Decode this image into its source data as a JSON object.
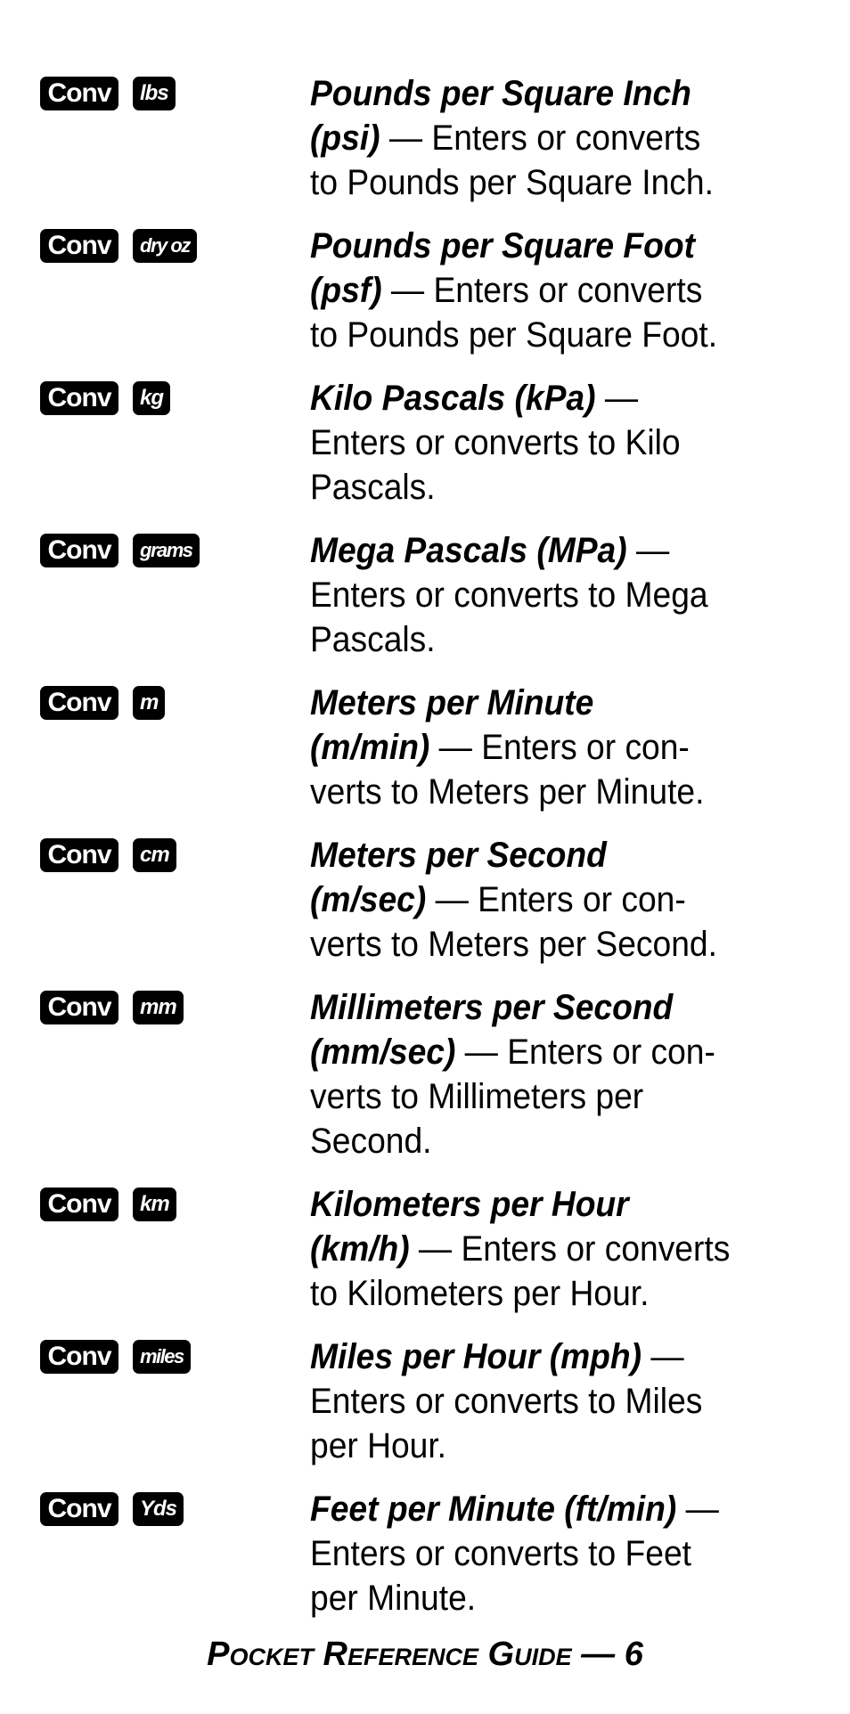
{
  "entries": [
    {
      "keys": [
        "Conv",
        "lbs"
      ],
      "lines": [
        [
          {
            "b": "Pounds per Square Inch"
          }
        ],
        [
          {
            "b": "(psi)"
          },
          {
            "t": " — Enters or converts"
          }
        ],
        [
          {
            "t": "to Pounds per Square Inch."
          }
        ]
      ]
    },
    {
      "keys": [
        "Conv",
        "dry oz"
      ],
      "lines": [
        [
          {
            "b": "Pounds per Square Foot"
          }
        ],
        [
          {
            "b": "(psf)"
          },
          {
            "t": " — Enters or converts"
          }
        ],
        [
          {
            "t": "to Pounds per Square Foot."
          }
        ]
      ]
    },
    {
      "keys": [
        "Conv",
        "kg"
      ],
      "lines": [
        [
          {
            "b": "Kilo Pascals (kPa)"
          },
          {
            "t": " —"
          }
        ],
        [
          {
            "t": "Enters or converts to Kilo"
          }
        ],
        [
          {
            "t": "Pascals."
          }
        ]
      ]
    },
    {
      "keys": [
        "Conv",
        "grams"
      ],
      "lines": [
        [
          {
            "b": "Mega Pascals (MPa)"
          },
          {
            "t": " —"
          }
        ],
        [
          {
            "t": "Enters or converts to Mega"
          }
        ],
        [
          {
            "t": "Pascals."
          }
        ]
      ]
    },
    {
      "keys": [
        "Conv",
        "m"
      ],
      "lines": [
        [
          {
            "b": "Meters per Minute"
          }
        ],
        [
          {
            "b": "(m/min)"
          },
          {
            "t": " — Enters or con-"
          }
        ],
        [
          {
            "t": "verts to Meters per Minute."
          }
        ]
      ]
    },
    {
      "keys": [
        "Conv",
        "cm"
      ],
      "lines": [
        [
          {
            "b": "Meters per Second"
          }
        ],
        [
          {
            "b": "(m/sec)"
          },
          {
            "t": " — Enters or con-"
          }
        ],
        [
          {
            "t": "verts to Meters per Second."
          }
        ]
      ]
    },
    {
      "keys": [
        "Conv",
        "mm"
      ],
      "lines": [
        [
          {
            "b": "Millimeters per Second"
          }
        ],
        [
          {
            "b": "(mm/sec)"
          },
          {
            "t": " — Enters or con-"
          }
        ],
        [
          {
            "t": "verts to Millimeters per"
          }
        ],
        [
          {
            "t": "Second."
          }
        ]
      ]
    },
    {
      "keys": [
        "Conv",
        "km"
      ],
      "lines": [
        [
          {
            "b": "Kilometers per Hour"
          }
        ],
        [
          {
            "b": "(km/h)"
          },
          {
            "t": " — Enters or converts"
          }
        ],
        [
          {
            "t": "to Kilometers per Hour."
          }
        ]
      ]
    },
    {
      "keys": [
        "Conv",
        "miles"
      ],
      "lines": [
        [
          {
            "b": "Miles per Hour (mph)"
          },
          {
            "t": " —"
          }
        ],
        [
          {
            "t": "Enters or converts to Miles"
          }
        ],
        [
          {
            "t": "per Hour."
          }
        ]
      ]
    },
    {
      "keys": [
        "Conv",
        "Yds"
      ],
      "lines": [
        [
          {
            "b": "Feet per Minute (ft/min)"
          },
          {
            "t": " —"
          }
        ],
        [
          {
            "t": "Enters or converts to Feet"
          }
        ],
        [
          {
            "t": "per Minute."
          }
        ]
      ]
    }
  ],
  "footer": {
    "title": "Pocket Reference Guide",
    "separator": " — ",
    "page_number": "6"
  }
}
